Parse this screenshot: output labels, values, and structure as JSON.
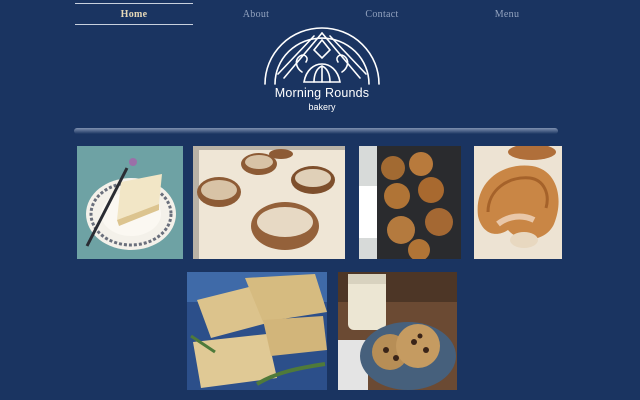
{
  "nav": {
    "items": [
      {
        "label": "Home",
        "active": true
      },
      {
        "label": "About",
        "active": false
      },
      {
        "label": "Contact",
        "active": false
      },
      {
        "label": "Menu",
        "active": false
      }
    ]
  },
  "logo": {
    "name": "Morning Rounds",
    "sub": "bakery"
  },
  "colors": {
    "background": "#1a3461",
    "nav_active_text": "#e7d9b8",
    "nav_text": "#93a3bf",
    "logo": "#ffffff"
  },
  "gallery": {
    "row1": [
      {
        "icon": "pie-slice-photo"
      },
      {
        "icon": "glazed-scones-photo"
      },
      {
        "icon": "muffins-photo"
      },
      {
        "icon": "croissant-photo"
      }
    ],
    "row2": [
      {
        "icon": "shortbread-rosemary-photo"
      },
      {
        "icon": "cookies-milk-photo"
      }
    ]
  }
}
